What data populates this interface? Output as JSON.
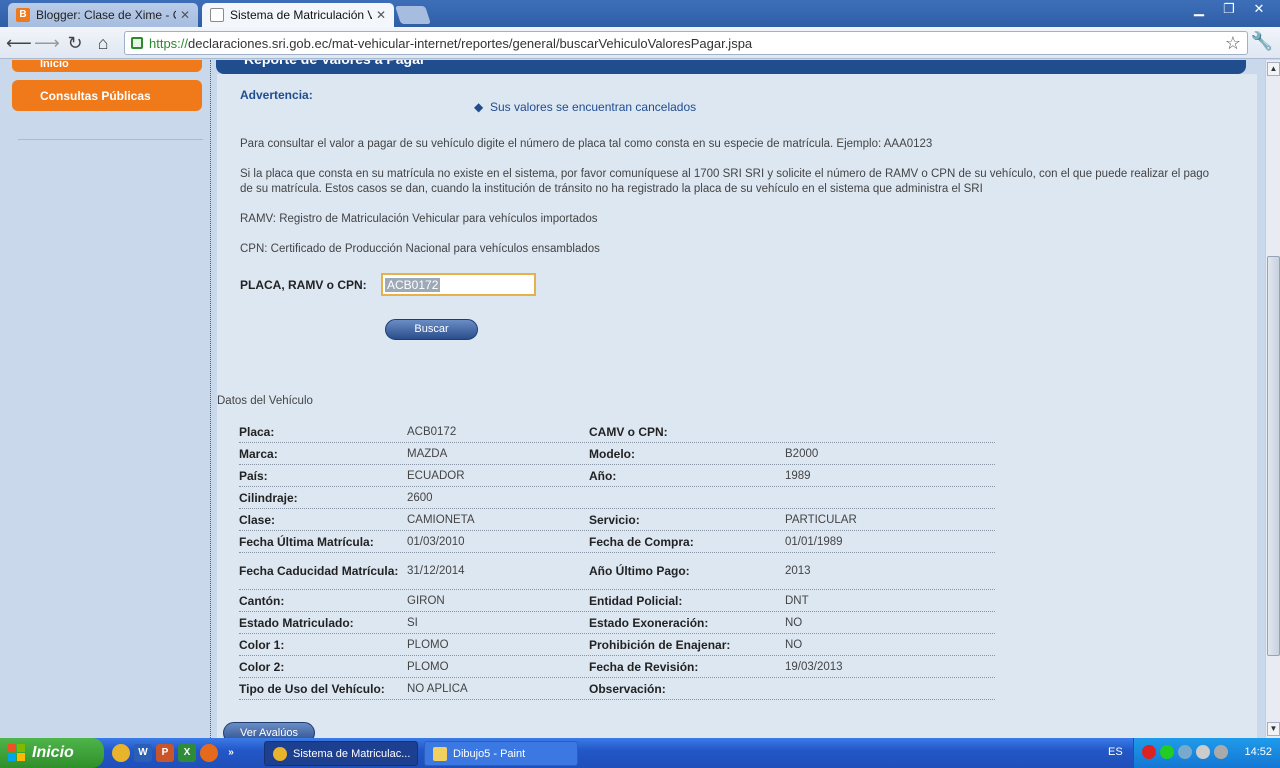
{
  "browser": {
    "tabs": [
      {
        "title": "Blogger: Clase de Xime - Cre",
        "active": false
      },
      {
        "title": "Sistema de Matriculación Veh",
        "active": true
      }
    ],
    "url_scheme": "https://",
    "url_rest": "declaraciones.sri.gob.ec/mat-vehicular-internet/reportes/general/buscarVehiculoValoresPagar.jspa"
  },
  "sidebar": {
    "inicio": "Inicio",
    "consultas": "Consultas Públicas"
  },
  "header": {
    "title": "Reporte de Valores a Pagar"
  },
  "advertencia": {
    "label": "Advertencia:",
    "item": "Sus valores se encuentran cancelados"
  },
  "paragraphs": {
    "p1": "Para consultar el valor a pagar de su vehículo digite el número de placa tal como consta en su especie de matrícula. Ejemplo: AAA0123",
    "p2": "Si la placa que consta en su matrícula no existe en el sistema, por favor comuníquese al 1700 SRI SRI y solicite el número de RAMV o CPN de su vehículo, con el que puede realizar el pago de su matrícula. Estos casos se dan, cuando la institución de tránsito no ha registrado la placa de su vehículo en el sistema que administra el SRI",
    "p3": "RAMV: Registro de Matriculación Vehicular para vehículos importados",
    "p4": "CPN: Certificado de Producción Nacional para vehículos ensamblados"
  },
  "search": {
    "label": "PLACA, RAMV o CPN:",
    "value": "ACB0172",
    "button": "Buscar"
  },
  "vehiculo": {
    "title": "Datos del Vehículo",
    "rows": [
      {
        "l1": "Placa:",
        "v1": "ACB0172",
        "l2": "CAMV o CPN:",
        "v2": ""
      },
      {
        "l1": "Marca:",
        "v1": "MAZDA",
        "l2": "Modelo:",
        "v2": "B2000"
      },
      {
        "l1": "País:",
        "v1": "ECUADOR",
        "l2": "Año:",
        "v2": "1989"
      },
      {
        "l1": "Cilindraje:",
        "v1": "2600",
        "l2": "",
        "v2": ""
      },
      {
        "l1": "Clase:",
        "v1": "CAMIONETA",
        "l2": "Servicio:",
        "v2": "PARTICULAR"
      },
      {
        "l1": "Fecha Última Matrícula:",
        "v1": "01/03/2010",
        "l2": "Fecha de Compra:",
        "v2": "01/01/1989"
      },
      {
        "l1": "Fecha Caducidad Matrícula:",
        "v1": "31/12/2014",
        "l2": "Año Último Pago:",
        "v2": "2013"
      },
      {
        "l1": "Cantón:",
        "v1": "GIRON",
        "l2": "Entidad Policial:",
        "v2": "DNT"
      },
      {
        "l1": "Estado Matriculado:",
        "v1": "SI",
        "l2": "Estado Exoneración:",
        "v2": "NO"
      },
      {
        "l1": "Color 1:",
        "v1": "PLOMO",
        "l2": "Prohibición de Enajenar:",
        "v2": "NO"
      },
      {
        "l1": "Color 2:",
        "v1": "PLOMO",
        "l2": "Fecha de Revisión:",
        "v2": "19/03/2013"
      },
      {
        "l1": "Tipo de Uso del Vehículo:",
        "v1": "NO APLICA",
        "l2": "Observación:",
        "v2": ""
      }
    ],
    "avaluos_button": "Ver Avalúos"
  },
  "taskbar": {
    "start": "Inicio",
    "tasks": [
      "Sistema de Matriculac...",
      "Dibujo5 - Paint"
    ],
    "lang": "ES",
    "clock": "14:52"
  },
  "colors": {
    "accent_orange": "#f07a1a",
    "header_blue": "#1f4d8e",
    "content_bg": "#dde7f2"
  }
}
